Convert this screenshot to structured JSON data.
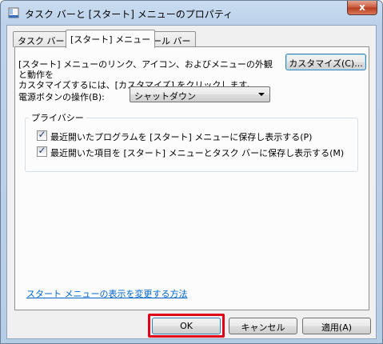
{
  "window": {
    "title": "タスク バーと [スタート] メニューのプロパティ",
    "close_glyph": "x"
  },
  "tabs": [
    {
      "label": "タスク バー",
      "active": false
    },
    {
      "label": "[スタート] メニュー",
      "active": true
    },
    {
      "label": "ツール バー",
      "active": false
    }
  ],
  "start_menu": {
    "description_line1": "[スタート] メニューのリンク、アイコン、およびメニューの外観と動作を",
    "description_line2": "カスタマイズするには、[カスタマイズ] をクリックします。",
    "customize_button": "カスタマイズ(C)...",
    "power_button_label": "電源ボタンの操作(B):",
    "power_button_value": "シャットダウン"
  },
  "privacy": {
    "title": "プライバシー",
    "options": [
      {
        "label": "最近開いたプログラムを [スタート] メニューに保存し表示する(P)",
        "checked": true
      },
      {
        "label": "最近開いた項目を [スタート] メニューとタスク バーに保存し表示する(M)",
        "checked": true
      }
    ]
  },
  "help_link": "スタート メニューの表示を変更する方法",
  "buttons": {
    "ok": "OK",
    "cancel": "キャンセル",
    "apply": "適用(A)"
  },
  "colors": {
    "highlight_border": "#e0001a",
    "link": "#0066cc"
  }
}
